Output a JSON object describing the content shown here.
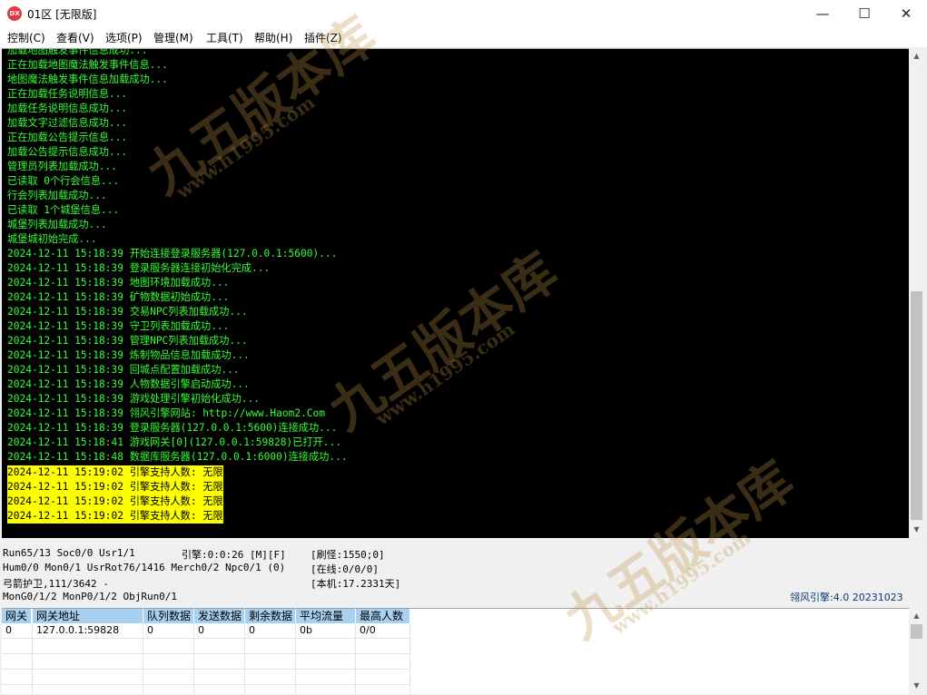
{
  "window": {
    "title": "01区 [无限版]",
    "icon_text": "DX",
    "minimize": "—",
    "maximize": "☐",
    "close": "✕"
  },
  "menu": [
    "控制(C)",
    "查看(V)",
    "选项(P)",
    "管理(M)",
    "工具(T)",
    "帮助(H)",
    "插件(Z)"
  ],
  "console": {
    "lines": [
      "加载地图触发事件信息成功...",
      "正在加载地图魔法触发事件信息...",
      "地图魔法触发事件信息加载成功...",
      "正在加载任务说明信息...",
      "加载任务说明信息成功...",
      "加载文字过滤信息成功...",
      "正在加载公告提示信息...",
      "加载公告提示信息成功...",
      "管理员列表加载成功...",
      "已读取 0个行会信息...",
      "行会列表加载成功...",
      "已读取 1个城堡信息...",
      "城堡列表加载成功...",
      "城堡城初始完成...",
      "2024-12-11 15:18:39 开始连接登录服务器(127.0.0.1:5600)...",
      "2024-12-11 15:18:39 登录服务器连接初始化完成...",
      "2024-12-11 15:18:39 地图环境加载成功...",
      "2024-12-11 15:18:39 矿物数据初始成功...",
      "2024-12-11 15:18:39 交易NPC列表加载成功...",
      "2024-12-11 15:18:39 守卫列表加载成功...",
      "2024-12-11 15:18:39 管理NPC列表加载成功...",
      "2024-12-11 15:18:39 炼制物品信息加载成功...",
      "2024-12-11 15:18:39 回城点配置加载成功...",
      "2024-12-11 15:18:39 人物数据引擎启动成功...",
      "2024-12-11 15:18:39 游戏处理引擎初始化成功...",
      "2024-12-11 15:18:39 翎风引擎网站: http://www.Haom2.Com",
      "2024-12-11 15:18:39 登录服务器(127.0.0.1:5600)连接成功...",
      "2024-12-11 15:18:41 游戏网关[0](127.0.0.1:59828)已打开...",
      "2024-12-11 15:18:48 数据库服务器(127.0.0.1:6000)连接成功..."
    ],
    "highlighted_lines": [
      "2024-12-11 15:19:02 引擎支持人数: 无限",
      "2024-12-11 15:19:02 引擎支持人数: 无限",
      "2024-12-11 15:19:02 引擎支持人数: 无限",
      "2024-12-11 15:19:02 引擎支持人数: 无限"
    ]
  },
  "status": {
    "line1": "Run65/13 Soc0/0 Usr1/1",
    "engine_time": "引擎:0:0:26 [M][F]",
    "refresh_monsters": "[刷怪:1550;0]",
    "line2": "Hum0/0 Mon0/1 UsrRot76/1416 Merch0/2 Npc0/1 (0)",
    "online": "[在线:0/0/0]",
    "line3": "弓箭护卫,111/3642 -",
    "local_machine": "[本机:17.2331天]",
    "line4": "MonG0/1/2 MonP0/1/2 ObjRun0/1",
    "engine_version": "翎风引擎:4.0 20231023"
  },
  "gateway_table": {
    "headers": [
      "网关",
      "网关地址",
      "队列数据",
      "发送数据",
      "剩余数据",
      "平均流量",
      "最高人数"
    ],
    "rows": [
      [
        "0",
        "127.0.0.1:59828",
        "0",
        "0",
        "0",
        "0b",
        "0/0"
      ]
    ]
  },
  "watermark": {
    "brand": "九五版本库",
    "url": "www.h1995.com"
  }
}
